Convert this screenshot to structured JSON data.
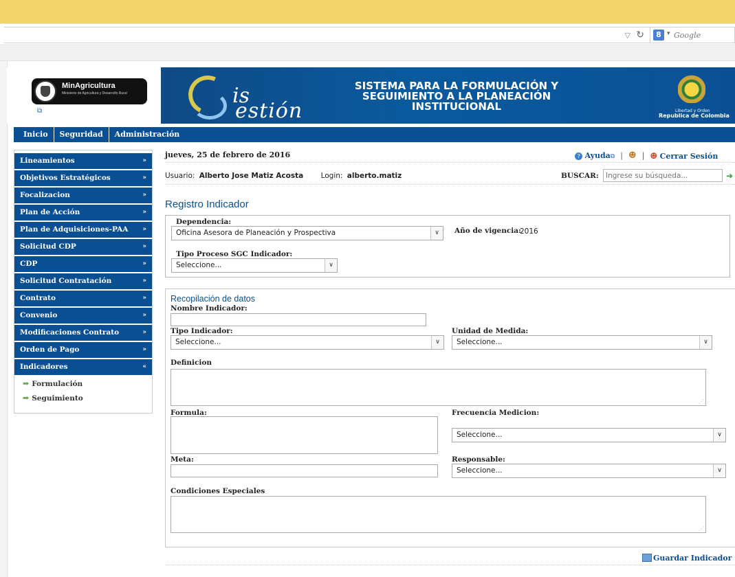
{
  "browser": {
    "search_engine": "Google",
    "search_badge": "8"
  },
  "header": {
    "logo_name": "MinAgricultura",
    "logo_sub": "Ministerio de Agricultura y Desarrollo Rural",
    "brand_is": "is",
    "brand_estion": "estión",
    "title": "SISTEMA PARA LA FORMULACIÓN Y SEGUIMIENTO A LA PLANEACIÓN INSTITUCIONAL",
    "libertad": "Libertad y Orden",
    "republica": "Republica de Colombia"
  },
  "topnav": {
    "items": [
      "Inicio",
      "Seguridad",
      "Administración"
    ]
  },
  "sidebar": {
    "items": [
      {
        "label": "Lineamientos",
        "icon": "»"
      },
      {
        "label": "Objetivos Estratégicos",
        "icon": "»"
      },
      {
        "label": "Focalizacion",
        "icon": "»"
      },
      {
        "label": "Plan de Acción",
        "icon": "»"
      },
      {
        "label": "Plan de Adquisiciones-PAA",
        "icon": "»"
      },
      {
        "label": "Solicitud CDP",
        "icon": "»"
      },
      {
        "label": "CDP",
        "icon": "»"
      },
      {
        "label": "Solicitud Contratación",
        "icon": "»"
      },
      {
        "label": "Contrato",
        "icon": "»"
      },
      {
        "label": "Convenio",
        "icon": "»"
      },
      {
        "label": "Modificaciones Contrato",
        "icon": "»"
      },
      {
        "label": "Orden de Pago",
        "icon": "»"
      },
      {
        "label": "Indicadores",
        "icon": "«"
      }
    ],
    "subitems": [
      "Formulación",
      "Seguimiento"
    ]
  },
  "main": {
    "date": "jueves, 25 de febrero de 2016",
    "help_label": "Ayuda",
    "logout_label": "Cerrar Sesión",
    "usuario_label": "Usuario:",
    "usuario_value": "Alberto Jose Matiz Acosta",
    "login_label": "Login:",
    "login_value": "alberto.matiz",
    "buscar_label": "BUSCAR:",
    "buscar_placeholder": "Ingrese su búsqueda...",
    "section_title": "Registro Indicador",
    "dependencia_label": "Dependencia:",
    "dependencia_value": "Oficina Asesora de Planeación y Prospectiva",
    "vigencia_label": "Año de vigencia:",
    "vigencia_value": "2016",
    "tipo_proceso_label": "Tipo Proceso SGC Indicador:",
    "tipo_proceso_value": "Seleccione...",
    "recopilacion_title": "Recopilación de datos",
    "nombre_label": "Nombre Indicador:",
    "tipo_indicador_label": "Tipo Indicador:",
    "tipo_indicador_value": "Seleccione...",
    "unidad_label": "Unidad de Medida:",
    "unidad_value": "Seleccione...",
    "definicion_label": "Definicion",
    "formula_label": "Formula:",
    "frecuencia_label": "Frecuencia Medicion:",
    "frecuencia_value": "Seleccione...",
    "meta_label": "Meta:",
    "responsable_label": "Responsable:",
    "responsable_value": "Seleccione...",
    "condiciones_label": "Condiciones Especiales",
    "save_label": "Guardar Indicador"
  }
}
